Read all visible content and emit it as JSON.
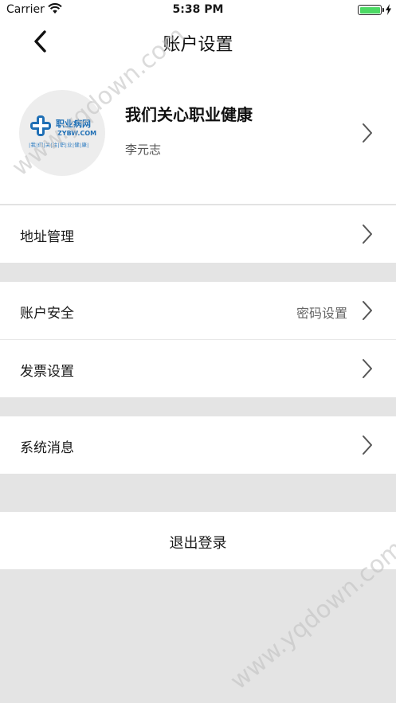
{
  "status_bar": {
    "carrier": "Carrier",
    "time": "5:38 PM",
    "icons": [
      "wifi-icon",
      "battery-icon",
      "charging-bolt-icon"
    ]
  },
  "nav": {
    "title": "账户设置",
    "back_icon": "chevron-left-icon"
  },
  "profile": {
    "name": "我们关心职业健康",
    "subname": "李元志",
    "avatar_logo": {
      "name": "职业病网",
      "domain": "ZYBW.COM",
      "slogan": "|我|们|关|注|职|业|健|康|"
    }
  },
  "menu": {
    "address": {
      "label": "地址管理"
    },
    "account_security": {
      "label": "账户安全",
      "value": "密码设置"
    },
    "invoice": {
      "label": "发票设置"
    },
    "system_messages": {
      "label": "系统消息"
    }
  },
  "logout": {
    "label": "退出登录"
  },
  "watermark": {
    "text": "www.yqdown.com"
  },
  "colors": {
    "background": "#e4e4e4",
    "surface": "#ffffff",
    "brand_blue": "#1f6fb5",
    "battery_green": "#4cd964"
  }
}
